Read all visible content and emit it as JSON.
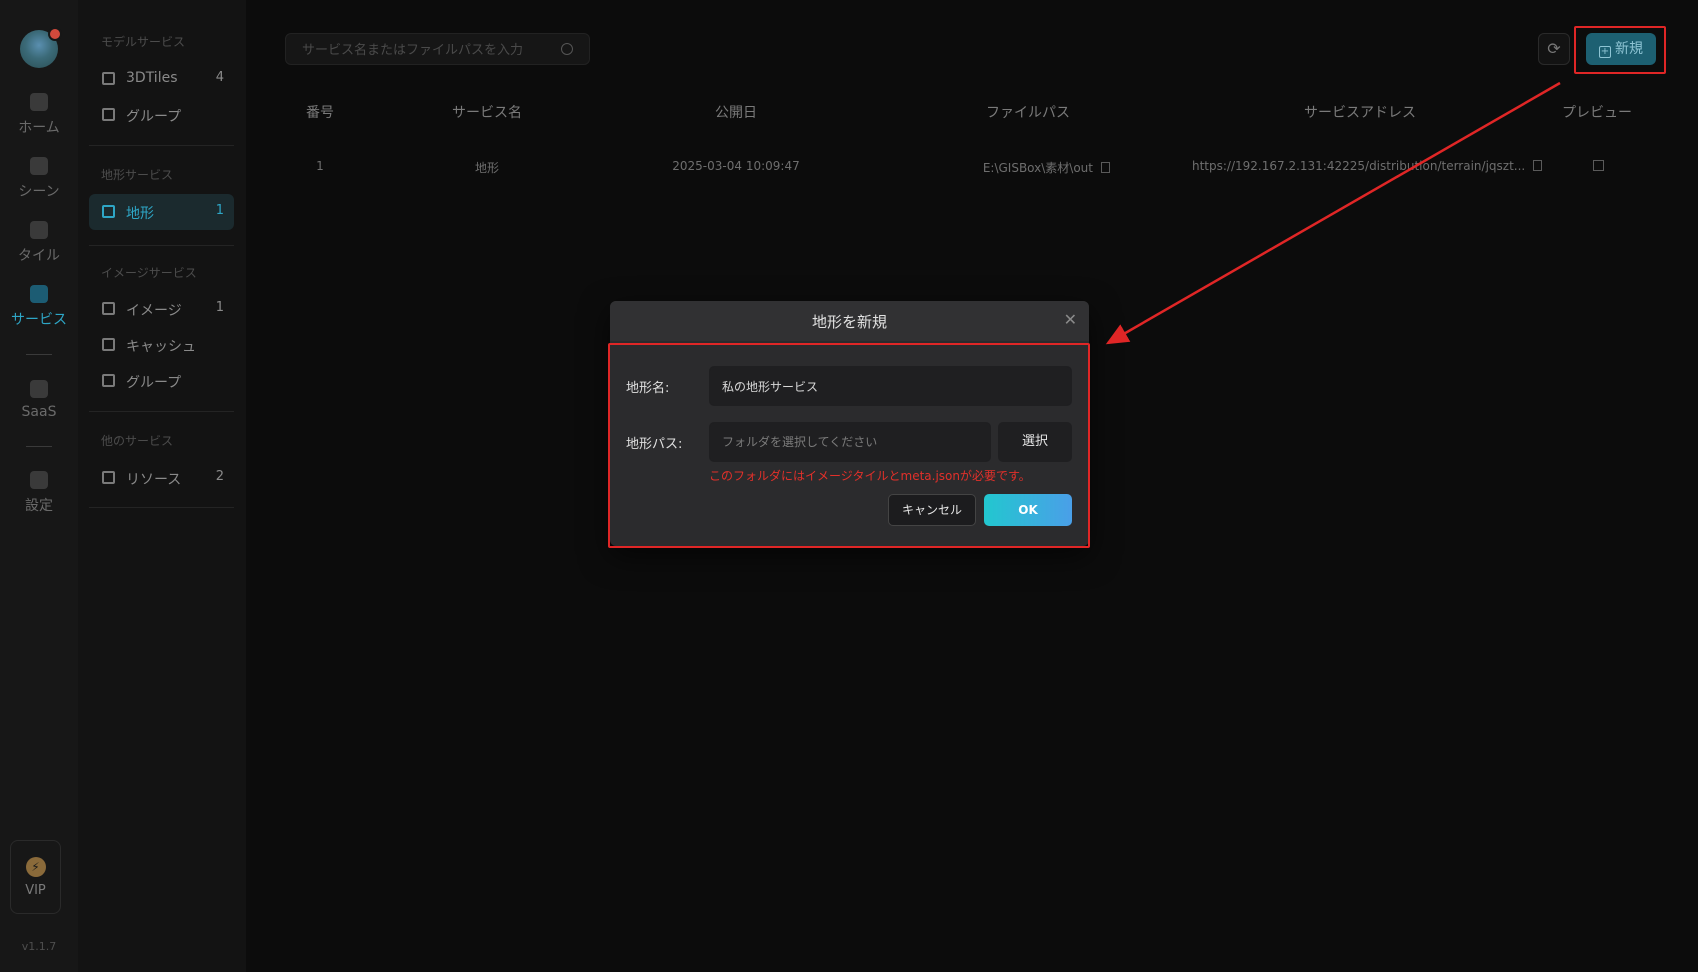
{
  "rail": {
    "items": [
      {
        "label": "ホーム",
        "icon": "home-icon",
        "active": false
      },
      {
        "label": "シーン",
        "icon": "scene-icon",
        "active": false
      },
      {
        "label": "タイル",
        "icon": "tile-icon",
        "active": false
      },
      {
        "label": "サービス",
        "icon": "service-icon",
        "active": true
      },
      {
        "label": "SaaS",
        "icon": "saas-icon",
        "active": false
      },
      {
        "label": "設定",
        "icon": "settings-icon",
        "active": false
      }
    ],
    "vip": "VIP",
    "version": "v1.1.7"
  },
  "sidebar": {
    "groups": [
      {
        "title": "モデルサービス",
        "items": [
          {
            "label": "3DTiles",
            "count": "4"
          },
          {
            "label": "グループ",
            "count": ""
          }
        ]
      },
      {
        "title": "地形サービス",
        "items": [
          {
            "label": "地形",
            "count": "1"
          }
        ]
      },
      {
        "title": "イメージサービス",
        "items": [
          {
            "label": "イメージ",
            "count": "1"
          },
          {
            "label": "キャッシュ",
            "count": ""
          },
          {
            "label": "グループ",
            "count": ""
          }
        ]
      },
      {
        "title": "他のサービス",
        "items": [
          {
            "label": "リソース",
            "count": "2"
          }
        ]
      }
    ]
  },
  "toolbar": {
    "search_placeholder": "サービス名またはファイルパスを入力",
    "new_label": "新規"
  },
  "table": {
    "headers": [
      "番号",
      "サービス名",
      "公開日",
      "ファイルパス",
      "サービスアドレス",
      "プレビュー"
    ],
    "rows": [
      [
        "1",
        "地形",
        "2025-03-04 10:09:47",
        "E:\\GISBox\\素材\\out",
        "https://192.167.2.131:42225/distribution/terrain/jqszt...",
        ""
      ]
    ]
  },
  "dialog": {
    "title": "地形を新規",
    "name_label": "地形名:",
    "name_value": "私の地形サービス",
    "path_label": "地形パス:",
    "path_placeholder": "フォルダを選択してください",
    "select_label": "選択",
    "hint": "このフォルダにはイメージタイルとmeta.jsonが必要です。",
    "cancel_label": "キャンセル",
    "ok_label": "OK"
  },
  "colors": {
    "accent": "#2ea6c6",
    "annotation": "#e02626",
    "error": "#e2302a"
  }
}
